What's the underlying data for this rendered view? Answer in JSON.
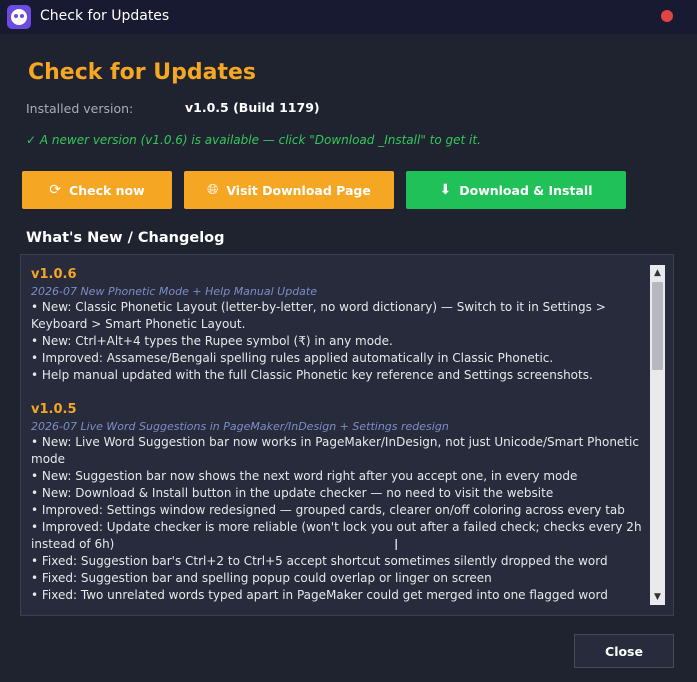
{
  "window": {
    "title": "Check for Updates"
  },
  "header": {
    "heading": "Check for Updates",
    "installed_label": "Installed version:",
    "installed_value": "v1.0.5 (Build 1179)",
    "status": "✓ A newer version (v1.0.6) is available — click \"Download _Install\" to get it."
  },
  "buttons": {
    "check_now": "Check now",
    "visit_page": "Visit Download Page",
    "download_install": "Download & Install",
    "close": "Close"
  },
  "icons": {
    "check_now": "refresh-icon",
    "visit_page": "globe-icon",
    "download_install": "download-arrow-icon"
  },
  "colors": {
    "accent": "#f5a623",
    "success": "#21c15a",
    "status_text": "#34c759",
    "background": "#1f2330"
  },
  "changelog": {
    "title": "What's New / Changelog",
    "versions": [
      {
        "version": "v1.0.6",
        "subtitle": "2026-07   New Phonetic Mode + Help Manual Update",
        "entries": [
          "• New: Classic Phonetic Layout (letter-by-letter, no word dictionary) — Switch to it in Settings > Keyboard > Smart Phonetic Layout.",
          "• New: Ctrl+Alt+4 types the Rupee symbol (₹) in any mode.",
          "• Improved: Assamese/Bengali spelling rules applied automatically in Classic Phonetic.",
          "• Help manual updated with the full Classic Phonetic key reference and Settings screenshots."
        ]
      },
      {
        "version": "v1.0.5",
        "subtitle": "2026-07   Live Word Suggestions in PageMaker/InDesign + Settings redesign",
        "entries": [
          "• New: Live Word Suggestion bar now works in PageMaker/InDesign, not just Unicode/Smart Phonetic mode",
          "• New: Suggestion bar now shows the next word right after you accept one, in every mode",
          "• New: Download & Install button in the update checker — no need to visit the website",
          "• Improved: Settings window redesigned — grouped cards, clearer on/off coloring across every tab",
          "• Improved: Update checker is more reliable (won't lock you out after a failed check; checks every 2h instead of 6h)",
          "• Fixed: Suggestion bar's Ctrl+2 to Ctrl+5 accept shortcut sometimes silently dropped the word",
          "• Fixed: Suggestion bar and spelling popup could overlap or linger on screen",
          "• Fixed: Two unrelated words typed apart in PageMaker could get merged into one flagged word"
        ]
      }
    ]
  }
}
